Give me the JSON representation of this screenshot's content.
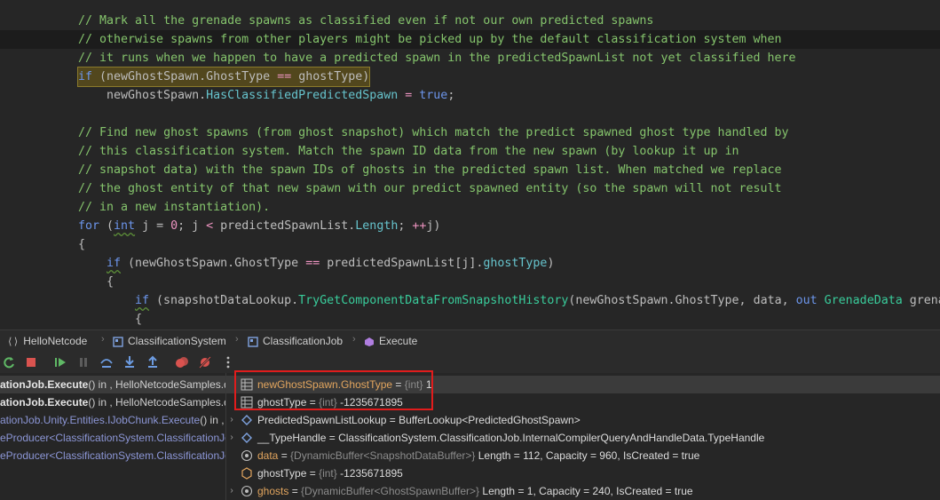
{
  "editor": {
    "lines": [
      {
        "kind": "comment",
        "text": "// Mark all the grenade spawns as classified even if not our own predicted spawns"
      },
      {
        "kind": "comment",
        "text": "// otherwise spawns from other players might be picked up by the default classification system when"
      },
      {
        "kind": "comment",
        "text": "// it runs when we happen to have a predicted spawn in the predictedSpawnList not yet classified here"
      },
      {
        "kind": "if",
        "tokens": [
          "if",
          " (",
          "newGhostSpawn",
          ".",
          "GhostType",
          " == ",
          "ghostType",
          ")"
        ]
      },
      {
        "kind": "assign",
        "tokens": [
          "newGhostSpawn",
          ".",
          "HasClassifiedPredictedSpawn",
          " = ",
          "true",
          ";"
        ]
      },
      {
        "kind": "blank",
        "text": ""
      },
      {
        "kind": "comment",
        "text": "// Find new ghost spawns (from ghost snapshot) which match the predict spawned ghost type handled by"
      },
      {
        "kind": "comment",
        "text": "// this classification system. Match the spawn ID data from the new spawn (by lookup it up in"
      },
      {
        "kind": "comment",
        "text": "// snapshot data) with the spawn IDs of ghosts in the predicted spawn list. When matched we replace"
      },
      {
        "kind": "comment",
        "text": "// the ghost entity of that new spawn with our predict spawned entity (so the spawn will not result"
      },
      {
        "kind": "comment",
        "text": "// in a new instantiation)."
      },
      {
        "kind": "for",
        "tokens": [
          "for",
          " (",
          "int",
          " j = ",
          "0",
          "; j ",
          "<",
          " predictedSpawnList",
          ".",
          "Length",
          "; ",
          "++",
          "j)"
        ]
      },
      {
        "kind": "brace",
        "text": "{"
      },
      {
        "kind": "if2",
        "tokens": [
          "if",
          " (",
          "newGhostSpawn",
          ".",
          "GhostType",
          " == ",
          "predictedSpawnList",
          "[j]",
          ".",
          "ghostType",
          ")"
        ]
      },
      {
        "kind": "brace2",
        "text": "{"
      },
      {
        "kind": "if3",
        "tokens": [
          "if",
          " (",
          "snapshotDataLookup",
          ".",
          "TryGetComponentDataFromSnapshotHistory",
          "(",
          "newGhostSpawn",
          ".",
          "GhostType",
          ", ",
          "data",
          ", ",
          "out",
          " ",
          "GrenadeData",
          " grena"
        ]
      },
      {
        "kind": "brace3",
        "text": "{"
      }
    ]
  },
  "breadcrumb": {
    "items": [
      "HelloNetcode",
      "ClassificationSystem",
      "ClassificationJob",
      "Execute"
    ]
  },
  "frames": [
    {
      "bold": "ationJob.Execute",
      "rest": "() in , HelloNetcodeSamples.dll"
    },
    {
      "bold": "ationJob.Execute",
      "rest": "() in , HelloNetcodeSamples.dll"
    },
    {
      "blue": "ationJob.Unity.Entities.IJobChunk.Execute",
      "rest": "() in ,"
    },
    {
      "blue": "eProducer",
      "rest": "<ClassificationSystem.ClassificationJo"
    },
    {
      "blue": "eProducer",
      "rest": "<ClassificationSystem.ClassificationJo"
    }
  ],
  "variables": [
    {
      "expand": "",
      "icon": "watch",
      "name": "newGhostSpawn.GhostType",
      "type": "{int}",
      "value": "1",
      "orange": true
    },
    {
      "expand": "",
      "icon": "watch",
      "name": "ghostType",
      "type": "{int}",
      "value": "-1235671895",
      "orange": false
    },
    {
      "expand": "›",
      "icon": "obj",
      "name": "PredictedSpawnListLookup",
      "type": "",
      "value": "BufferLookup<PredictedGhostSpawn>",
      "orange": false
    },
    {
      "expand": "›",
      "icon": "obj",
      "name": "__TypeHandle",
      "type": "",
      "value": "ClassificationSystem.ClassificationJob.InternalCompilerQueryAndHandleData.TypeHandle",
      "orange": false
    },
    {
      "expand": "",
      "icon": "local",
      "name": "data",
      "type": "{DynamicBuffer<SnapshotDataBuffer>}",
      "value": "Length = 112, Capacity = 960, IsCreated = true",
      "orange": true
    },
    {
      "expand": "",
      "icon": "local-plain",
      "name": "ghostType",
      "type": "{int}",
      "value": "-1235671895",
      "orange": false
    },
    {
      "expand": "›",
      "icon": "local",
      "name": "ghosts",
      "type": "{DynamicBuffer<GhostSpawnBuffer>}",
      "value": "Length = 1, Capacity = 240, IsCreated = true",
      "orange": true
    }
  ],
  "colors": {
    "accent_red": "#e01c1c",
    "comment": "#85c46c",
    "keyword": "#6c95eb"
  }
}
